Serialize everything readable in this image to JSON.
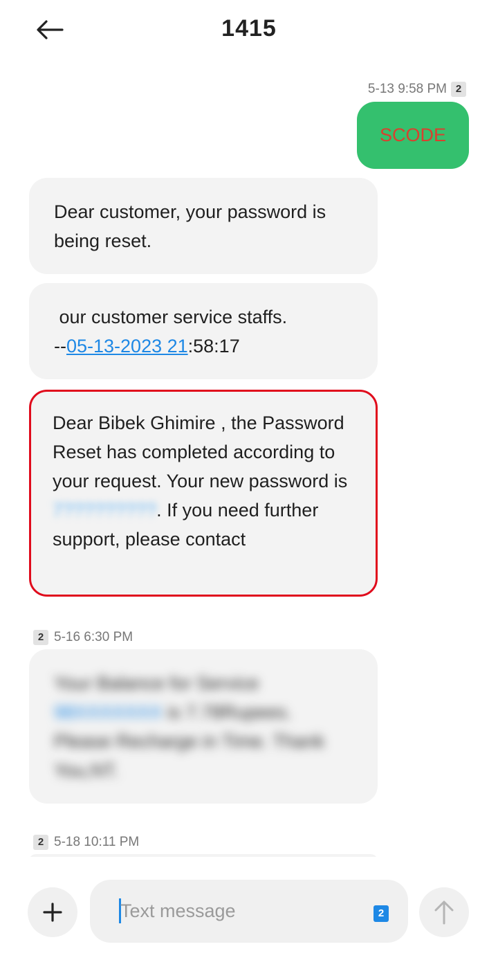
{
  "header": {
    "title": "1415",
    "back_icon": "arrow-left-icon"
  },
  "messages": [
    {
      "type": "timestamp",
      "text": "5-13 9:58 PM",
      "sim": "2"
    },
    {
      "type": "sent",
      "text": "SCODE"
    },
    {
      "type": "received",
      "text": "Dear customer, your password is being reset."
    },
    {
      "type": "received",
      "line1": " our customer service staffs.",
      "prefix": "--",
      "link": "05-13-2023 21",
      "suffix": ":58:17"
    },
    {
      "type": "received",
      "highlighted": true,
      "part1": "Dear Bibek Ghimire , the Password Reset has completed according to your request. Your new password is ",
      "password": "7?????????",
      "part2": ". If you need further support, please contact",
      "highlight_color": "#e00b1c"
    },
    {
      "type": "timestamp",
      "text": "5-16 6:30 PM",
      "sim": "2"
    },
    {
      "type": "received",
      "blurred": true,
      "part1": "Your Balance for Service ",
      "number": "98XXXXXXX",
      "part2": " is 7.78Rupees. Please Recharge in Time. Thank You,NT."
    },
    {
      "type": "timestamp",
      "text": "5-18 10:11 PM",
      "sim": "2"
    }
  ],
  "composer": {
    "add_icon": "plus-icon",
    "placeholder": "Text message",
    "value": "",
    "sim": "2",
    "send_icon": "arrow-up-icon"
  },
  "colors": {
    "sent_bubble": "#34c06e",
    "sent_text": "#d8412f",
    "received_bubble": "#f3f3f3",
    "link": "#1e88e5",
    "highlight_border": "#e00b1c"
  }
}
